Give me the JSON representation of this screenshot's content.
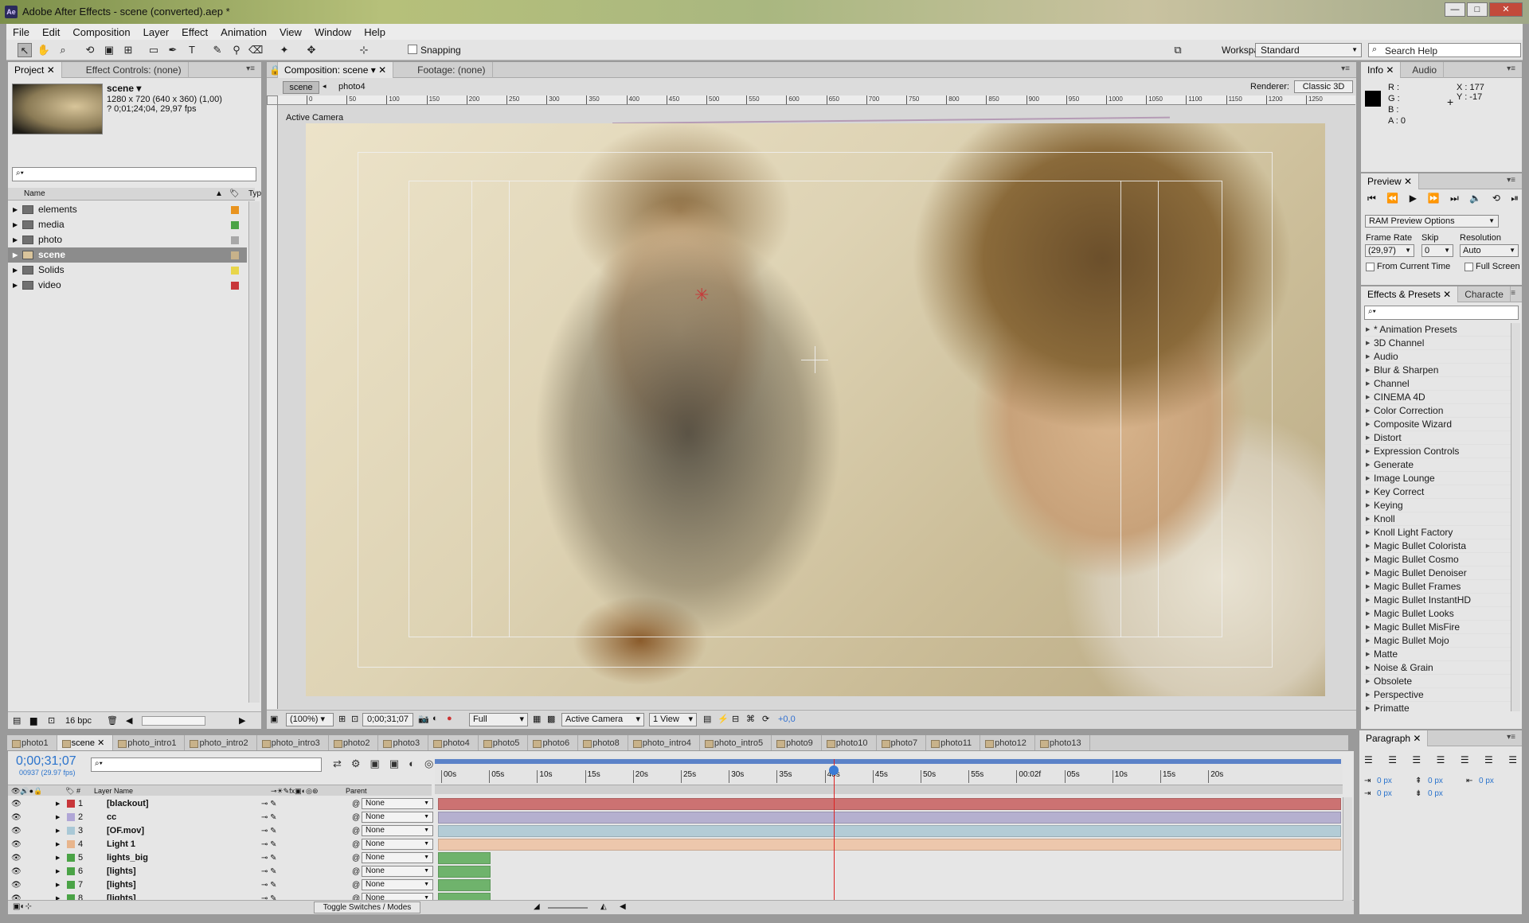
{
  "app": {
    "title": "Adobe After Effects - scene (converted).aep *",
    "icon": "Ae"
  },
  "window_buttons": {
    "minimize": "—",
    "maximize": "□",
    "close": "✕"
  },
  "menu": [
    "File",
    "Edit",
    "Composition",
    "Layer",
    "Effect",
    "Animation",
    "View",
    "Window",
    "Help"
  ],
  "toolbar": {
    "snapping": "Snapping",
    "workspace_label": "Workspace:",
    "workspace_value": "Standard",
    "search_placeholder": "Search Help"
  },
  "project": {
    "tab1": "Project",
    "tab2": "Effect Controls: (none)",
    "comp_name": "scene ▾",
    "comp_info1": "1280 x 720  (640 x 360) (1,00)",
    "comp_info2": "? 0;01;24;04, 29,97 fps",
    "col_name": "Name",
    "col_type": "Typ",
    "bpc": "16 bpc",
    "items": [
      {
        "name": "elements",
        "color": "#e8931e"
      },
      {
        "name": "media",
        "color": "#4aa346"
      },
      {
        "name": "photo",
        "color": "#a8a8a8"
      },
      {
        "name": "scene",
        "color": "#c8b28a"
      },
      {
        "name": "Solids",
        "color": "#e8d54a"
      },
      {
        "name": "video",
        "color": "#c8363a"
      }
    ]
  },
  "comp": {
    "tab1": "Composition: scene",
    "tab2": "Footage: (none)",
    "crumb1": "scene",
    "crumb2": "photo4",
    "renderer_label": "Renderer:",
    "renderer_value": "Classic 3D",
    "camera_label": "Active Camera",
    "ruler_ticks": [
      "0",
      "50",
      "100",
      "150",
      "200",
      "250",
      "300",
      "350",
      "400",
      "450",
      "500",
      "550",
      "600",
      "650",
      "700",
      "750",
      "800",
      "850",
      "900",
      "950",
      "1000",
      "1050",
      "1100",
      "1150",
      "1200",
      "1250"
    ],
    "bottom": {
      "zoom": "(100%)",
      "timecode": "0;00;31;07",
      "quality": "Full",
      "view": "Active Camera",
      "views": "1 View",
      "exposure": "+0,0"
    }
  },
  "info": {
    "tab1": "Info",
    "tab2": "Audio",
    "r": "R :",
    "g": "G :",
    "b": "B :",
    "a": "A : 0",
    "x": "X : 177",
    "y": "Y : -17"
  },
  "preview": {
    "tab": "Preview",
    "ram": "RAM Preview Options",
    "frame_rate_label": "Frame Rate",
    "skip_label": "Skip",
    "resolution_label": "Resolution",
    "frame_rate": "(29,97)",
    "skip": "0",
    "resolution": "Auto",
    "from_current": "From Current Time",
    "full_screen": "Full Screen"
  },
  "effects": {
    "tab1": "Effects & Presets",
    "tab2": "Characte",
    "items": [
      "* Animation Presets",
      "3D Channel",
      "Audio",
      "Blur & Sharpen",
      "Channel",
      "CINEMA 4D",
      "Color Correction",
      "Composite Wizard",
      "Distort",
      "Expression Controls",
      "Generate",
      "Image Lounge",
      "Key Correct",
      "Keying",
      "Knoll",
      "Knoll Light Factory",
      "Magic Bullet Colorista",
      "Magic Bullet Cosmo",
      "Magic Bullet Denoiser",
      "Magic Bullet Frames",
      "Magic Bullet InstantHD",
      "Magic Bullet Looks",
      "Magic Bullet MisFire",
      "Magic Bullet Mojo",
      "Matte",
      "Noise & Grain",
      "Obsolete",
      "Perspective",
      "Primatte"
    ]
  },
  "paragraph": {
    "tab": "Paragraph",
    "v1": "0 px",
    "v2": "0 px",
    "v3": "0 px",
    "v4": "0 px",
    "v5": "0 px"
  },
  "timeline": {
    "tabs": [
      "photo1",
      "scene",
      "photo_intro1",
      "photo_intro2",
      "photo_intro3",
      "photo2",
      "photo3",
      "photo4",
      "photo5",
      "photo6",
      "photo8",
      "photo_intro4",
      "photo_intro5",
      "photo9",
      "photo10",
      "photo7",
      "photo11",
      "photo12",
      "photo13"
    ],
    "timecode": "0;00;31;07",
    "frames": "00937 (29.97 fps)",
    "col_layer": "Layer Name",
    "col_parent": "Parent",
    "col_hash": "#",
    "ruler": [
      "00s",
      "05s",
      "10s",
      "15s",
      "20s",
      "25s",
      "30s",
      "35s",
      "40s",
      "45s",
      "50s",
      "55s",
      "00:02f",
      "05s",
      "10s",
      "15s",
      "20s"
    ],
    "toggle": "Toggle Switches / Modes",
    "layers": [
      {
        "num": "1",
        "name": "[blackout]",
        "label": "#c8363a",
        "parent": "None",
        "bar": "#cc7272",
        "start": 0,
        "end": 1
      },
      {
        "num": "2",
        "name": "cc",
        "label": "#b0a6d6",
        "parent": "None",
        "bar": "#b5b0cf",
        "start": 0,
        "end": 1
      },
      {
        "num": "3",
        "name": "[OF.mov]",
        "label": "#a9c8d6",
        "parent": "None",
        "bar": "#b3ccd6",
        "start": 0,
        "end": 1
      },
      {
        "num": "4",
        "name": "Light 1",
        "label": "#e8b58c",
        "parent": "None",
        "bar": "#edc7ac",
        "start": 0,
        "end": 1
      },
      {
        "num": "5",
        "name": "lights_big",
        "label": "#4aa346",
        "parent": "None",
        "bar": "#6fb36c",
        "start": 0,
        "end": 0.058
      },
      {
        "num": "6",
        "name": "[lights]",
        "label": "#4aa346",
        "parent": "None",
        "bar": "#6fb36c",
        "start": 0,
        "end": 0.058
      },
      {
        "num": "7",
        "name": "[lights]",
        "label": "#4aa346",
        "parent": "None",
        "bar": "#6fb36c",
        "start": 0,
        "end": 0.058
      },
      {
        "num": "8",
        "name": "[lights]",
        "label": "#4aa346",
        "parent": "None",
        "bar": "#6fb36c",
        "start": 0,
        "end": 0.058
      }
    ]
  }
}
